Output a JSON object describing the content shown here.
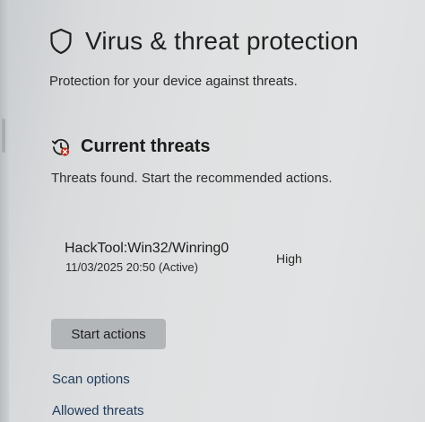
{
  "page": {
    "title": "Virus & threat protection",
    "subtitle": "Protection for your device against threats.",
    "title_icon": "shield-icon"
  },
  "current_threats": {
    "title": "Current threats",
    "icon": "threat-history-icon",
    "description": "Threats found. Start the recommended actions.",
    "threats": [
      {
        "name": "HackTool:Win32/Winring0",
        "date": "11/03/2025 20:50 (Active)",
        "severity": "High"
      }
    ],
    "start_actions_label": "Start actions"
  },
  "links": {
    "scan_options": "Scan options",
    "allowed_threats": "Allowed threats"
  },
  "colors": {
    "background": "#dfe1e2",
    "button": "#b3b6b9",
    "threat_badge": "#c42b1c"
  }
}
